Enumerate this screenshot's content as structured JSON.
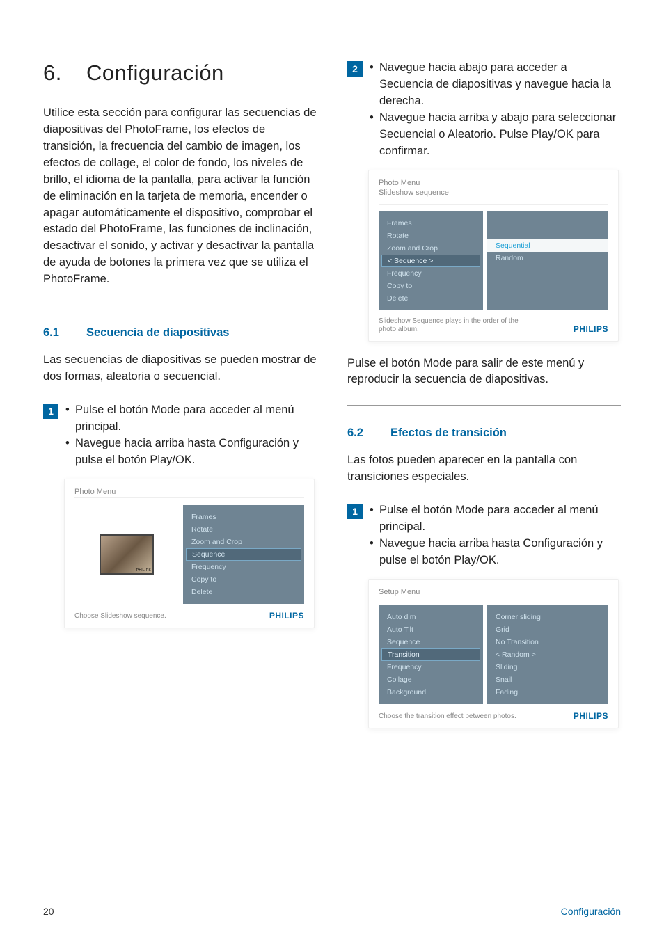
{
  "chapter": {
    "number": "6.",
    "title": "Configuración"
  },
  "left": {
    "intro": "Utilice esta sección para configurar las secuencias de diapositivas del PhotoFrame, los efectos de transición, la frecuencia del cambio de imagen, los efectos de collage, el color de fondo, los niveles de brillo, el idioma de la pantalla, para activar la función de eliminación en la tarjeta de memoria, encender o apagar automáticamente el dispositivo, comprobar el estado del PhotoFrame, las funciones de inclinación, desactivar el sonido, y activar y desactivar la pantalla de ayuda de botones la primera vez que se utiliza el PhotoFrame.",
    "s61": {
      "num": "6.1",
      "title": "Secuencia de diapositivas",
      "lead": "Las secuencias de diapositivas se pueden mostrar de dos formas, aleatoria o secuencial.",
      "step1": {
        "badge": "1",
        "b1": "Pulse el botón Mode para acceder al menú principal.",
        "b2": "Navegue hacia arriba hasta Configuración y pulse el botón Play/OK."
      },
      "shot1": {
        "crumb1": "Photo Menu",
        "menu": [
          "Frames",
          "Rotate",
          "Zoom and Crop",
          "Sequence",
          "Frequency",
          "Copy to",
          "Delete"
        ],
        "sel": "Sequence",
        "caption": "Choose Slideshow sequence.",
        "brand": "PHILIPS"
      }
    }
  },
  "right": {
    "step2": {
      "badge": "2",
      "b1": "Navegue hacia abajo para acceder a Secuencia de diapositivas y navegue hacia la derecha.",
      "b2": "Navegue hacia arriba y abajo para seleccionar Secuencial o Aleatorio. Pulse Play/OK para confirmar."
    },
    "shot2": {
      "crumb1": "Photo Menu",
      "crumb2": "Slideshow sequence",
      "left": [
        "Frames",
        "Rotate",
        "Zoom and Crop",
        "< Sequence >",
        "Frequency",
        "Copy to",
        "Delete"
      ],
      "sel": "< Sequence >",
      "right": [
        "Sequential",
        "Random"
      ],
      "rhl": "Sequential",
      "caption": "Slideshow Sequence plays in the order of the photo album.",
      "brand": "PHILIPS"
    },
    "after2": "Pulse el botón Mode para salir de este menú y reproducir la secuencia de diapositivas.",
    "s62": {
      "num": "6.2",
      "title": "Efectos de transición",
      "lead": "Las fotos pueden aparecer en la pantalla con transiciones especiales.",
      "step1": {
        "badge": "1",
        "b1": "Pulse el botón Mode para acceder al menú principal.",
        "b2": "Navegue hacia arriba hasta Configuración y pulse el botón Play/OK."
      },
      "shot": {
        "crumb1": "Setup Menu",
        "left": [
          "Auto dim",
          "Auto Tilt",
          "Sequence",
          "Transition",
          "Frequency",
          "Collage",
          "Background"
        ],
        "sel": "Transition",
        "right": [
          "Corner sliding",
          "Grid",
          "No Transition",
          "< Random >",
          "Sliding",
          "Snail",
          "Fading"
        ],
        "caption": "Choose the transition effect between photos.",
        "brand": "PHILIPS"
      }
    }
  },
  "footer": {
    "page": "20",
    "section": "Configuración"
  }
}
